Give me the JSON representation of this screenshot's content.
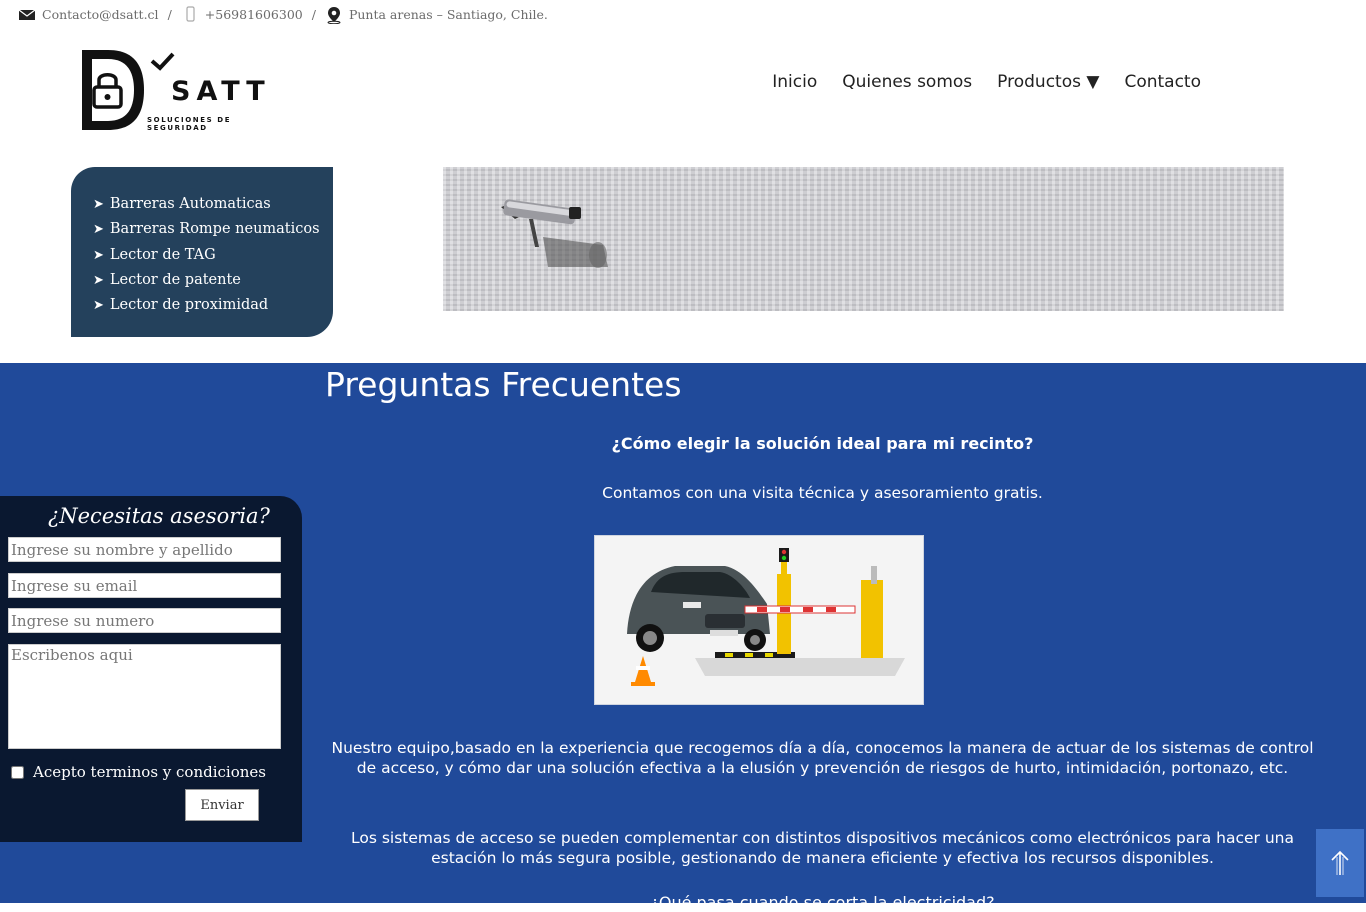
{
  "topbar": {
    "email": "Contacto@dsatt.cl",
    "phone": "+56981606300",
    "location": "Punta arenas – Santiago, Chile.",
    "separator": "/"
  },
  "logo": {
    "name": "SATT",
    "tagline": "SOLUCIONES DE SEGURIDAD"
  },
  "nav": {
    "items": [
      "Inicio",
      "Quienes somos",
      "Productos ▼",
      "Contacto"
    ]
  },
  "sidemenu": {
    "items": [
      "Barreras Automaticas",
      "Barreras Rompe neumaticos",
      "Lector de TAG",
      "Lector de patente",
      "Lector de proximidad"
    ]
  },
  "faq": {
    "title": "Preguntas Frecuentes",
    "question1": "¿Cómo elegir la solución ideal para mi recinto?",
    "answer1": "Contamos con una visita técnica y asesoramiento gratis.",
    "paragraph1": "Nuestro equipo,basado en la experiencia que recogemos día a día, conocemos la manera de actuar de los sistemas de control de acceso, y cómo dar una solución efectiva a la elusión y prevención de riesgos de hurto, intimidación, portonazo, etc.",
    "paragraph2": "Los sistemas de acceso se pueden complementar con distintos dispositivos mecánicos como electrónicos para hacer una estación lo más segura posible, gestionando de manera eficiente y efectiva los recursos disponibles.",
    "question2": "¿Qué pasa cuando se corta la electricidad?"
  },
  "form": {
    "title": "¿Necesitas asesoria?",
    "name_placeholder": "Ingrese su nombre y apellido",
    "email_placeholder": "Ingrese su email",
    "phone_placeholder": "Ingrese su numero",
    "message_placeholder": "Escribenos aqui",
    "terms_label": "Acepto terminos y condiciones",
    "submit_label": "Enviar"
  },
  "colors": {
    "blue_section": "#204a9a",
    "sidemenu": "#24415c",
    "form_bg": "#0a1830",
    "scroll_top": "#3f71c6"
  },
  "icons": [
    "mail-icon",
    "phone-icon",
    "location-icon",
    "arrow-up-icon"
  ]
}
